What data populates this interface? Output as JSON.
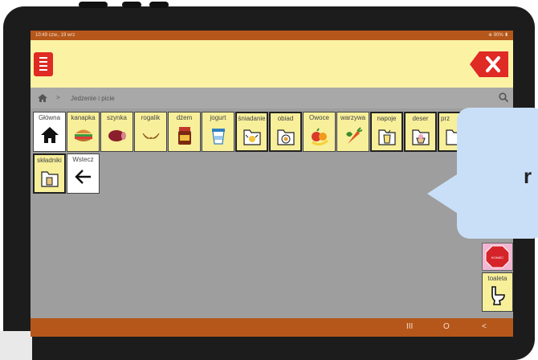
{
  "status": {
    "time": "10:49  czw., 19 wrz",
    "battery": "90%"
  },
  "breadcrumb": {
    "current": "Jedzenie i picie",
    "separator": ">"
  },
  "cells": [
    {
      "label": "Główna",
      "icon": "home-icon",
      "bg": "white"
    },
    {
      "label": "kanapka",
      "icon": "sandwich-icon",
      "bg": "yellow"
    },
    {
      "label": "szynka",
      "icon": "ham-icon",
      "bg": "yellow"
    },
    {
      "label": "rogalik",
      "icon": "croissant-icon",
      "bg": "yellow"
    },
    {
      "label": "dżem",
      "icon": "jam-jar-icon",
      "bg": "yellow"
    },
    {
      "label": "jogurt",
      "icon": "yogurt-icon",
      "bg": "yellow"
    },
    {
      "label": "śniadanie",
      "icon": "breakfast-folder-icon",
      "bg": "yellow"
    },
    {
      "label": "obiad",
      "icon": "dinner-folder-icon",
      "bg": "yellow"
    },
    {
      "label": "Owoce",
      "icon": "fruits-icon",
      "bg": "yellow"
    },
    {
      "label": "warzywa",
      "icon": "vegetables-icon",
      "bg": "yellow"
    },
    {
      "label": "napoje",
      "icon": "drinks-folder-icon",
      "bg": "yellow"
    },
    {
      "label": "deser",
      "icon": "dessert-folder-icon",
      "bg": "yellow"
    },
    {
      "label": "prz",
      "icon": "folder-icon",
      "bg": "yellow"
    },
    {
      "label": "składniki",
      "icon": "ingredients-folder-icon",
      "bg": "yellow"
    },
    {
      "label": "Wstecz",
      "icon": "arrow-left-icon",
      "bg": "white"
    }
  ],
  "side": {
    "stop_label": "KONIEC",
    "toilet_label": "toaleta"
  },
  "nav": {
    "recents": "III",
    "home": "O",
    "back": "<"
  },
  "bubble": {
    "text": "r"
  },
  "colors": {
    "accent": "#b5571b",
    "topbar": "#fbf2a4",
    "cell": "#f7ef9a",
    "delete": "#e02a24",
    "bubble": "#c9dff8"
  }
}
